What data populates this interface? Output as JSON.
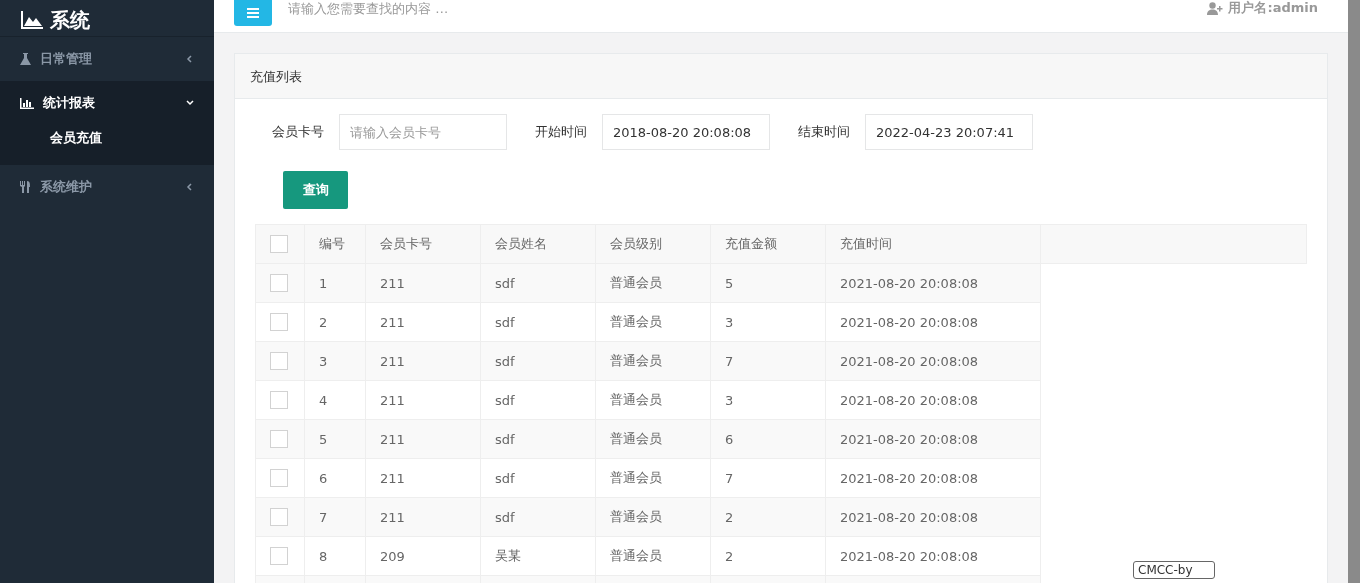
{
  "sidebar": {
    "logo": "系统",
    "items": [
      {
        "label": "日常管理",
        "expanded": false
      },
      {
        "label": "统计报表",
        "expanded": true,
        "children": [
          {
            "label": "会员充值",
            "selected": true
          }
        ]
      },
      {
        "label": "系统维护",
        "expanded": false
      }
    ]
  },
  "topbar": {
    "search_placeholder": "请输入您需要查找的内容 …",
    "user": "用户名:admin"
  },
  "panel": {
    "title": "充值列表",
    "filters": [
      {
        "label": "会员卡号",
        "placeholder": "请输入会员卡号"
      },
      {
        "label": "开始时间",
        "value": "2018-08-20 20:08:08"
      },
      {
        "label": "结束时间",
        "value": "2022-04-23 20:07:41"
      }
    ],
    "query_button": "查询",
    "table": {
      "header_checked": false,
      "columns": [
        "编号",
        "会员卡号",
        "会员姓名",
        "会员级别",
        "充值金额",
        "充值时间"
      ],
      "rows": [
        {
          "checked": false,
          "cells": [
            "1",
            "211",
            "sdf",
            "普通会员",
            "5",
            "2021-08-20 20:08:08"
          ]
        },
        {
          "checked": false,
          "cells": [
            "2",
            "211",
            "sdf",
            "普通会员",
            "3",
            "2021-08-20 20:08:08"
          ]
        },
        {
          "checked": false,
          "cells": [
            "3",
            "211",
            "sdf",
            "普通会员",
            "7",
            "2021-08-20 20:08:08"
          ]
        },
        {
          "checked": false,
          "cells": [
            "4",
            "211",
            "sdf",
            "普通会员",
            "3",
            "2021-08-20 20:08:08"
          ]
        },
        {
          "checked": false,
          "cells": [
            "5",
            "211",
            "sdf",
            "普通会员",
            "6",
            "2021-08-20 20:08:08"
          ]
        },
        {
          "checked": false,
          "cells": [
            "6",
            "211",
            "sdf",
            "普通会员",
            "7",
            "2021-08-20 20:08:08"
          ]
        },
        {
          "checked": false,
          "cells": [
            "7",
            "211",
            "sdf",
            "普通会员",
            "2",
            "2021-08-20 20:08:08"
          ]
        },
        {
          "checked": false,
          "cells": [
            "8",
            "209",
            "吴某",
            "普通会员",
            "2",
            "2021-08-20 20:08:08"
          ]
        }
      ]
    }
  },
  "tooltip": "CMCC-by"
}
